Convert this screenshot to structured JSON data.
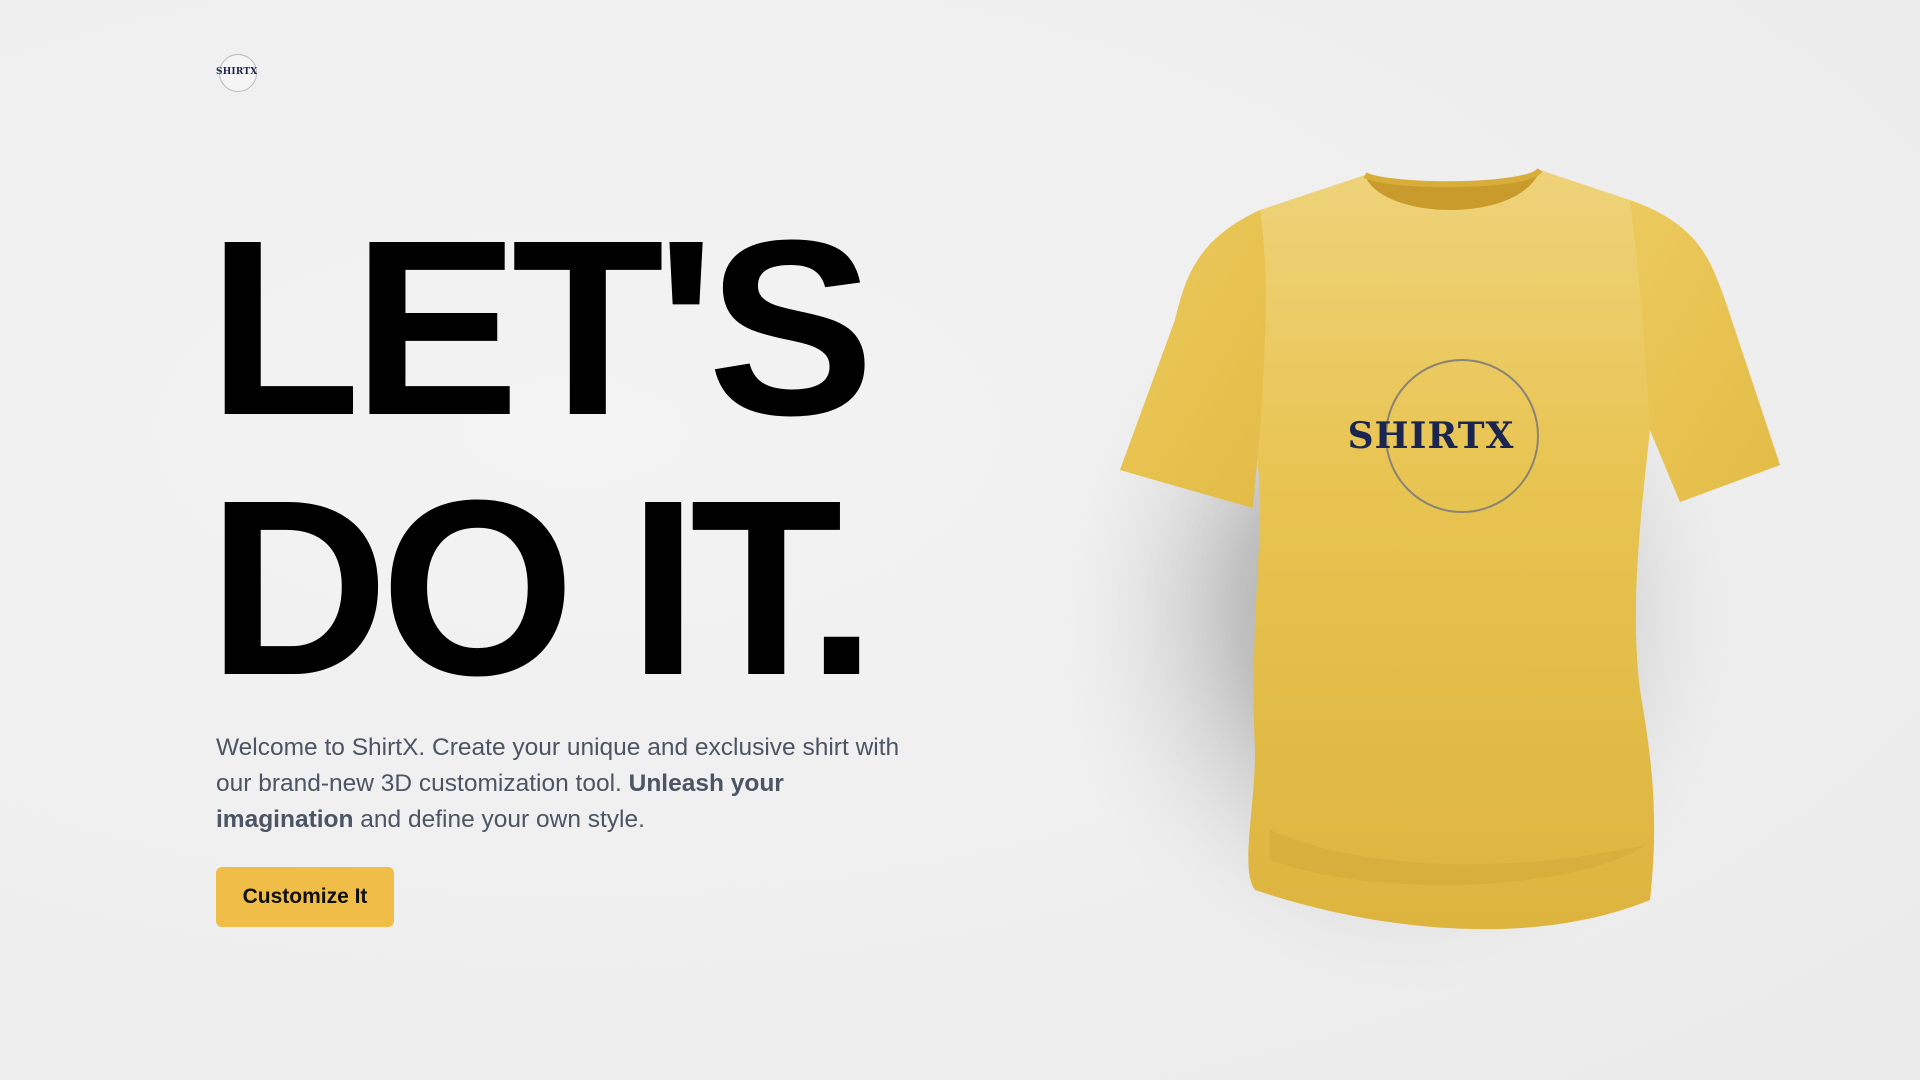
{
  "brand": {
    "logo_text": "SHIRTX"
  },
  "hero": {
    "line1": "LET'S",
    "line2": "DO IT."
  },
  "description": {
    "part1": "Welcome to ShirtX. Create your unique and exclusive shirt with our brand-new 3D customization tool. ",
    "bold": "Unleash your imagination",
    "part2": " and define your own style."
  },
  "cta": {
    "label": "Customize It"
  },
  "shirt": {
    "print_text": "SHIRTX",
    "color": "#e8c24f",
    "print_color": "#1a2550"
  },
  "colors": {
    "background": "#efefef",
    "accent": "#efbd48",
    "text_dark": "#000000",
    "text_muted": "#4b5563"
  }
}
